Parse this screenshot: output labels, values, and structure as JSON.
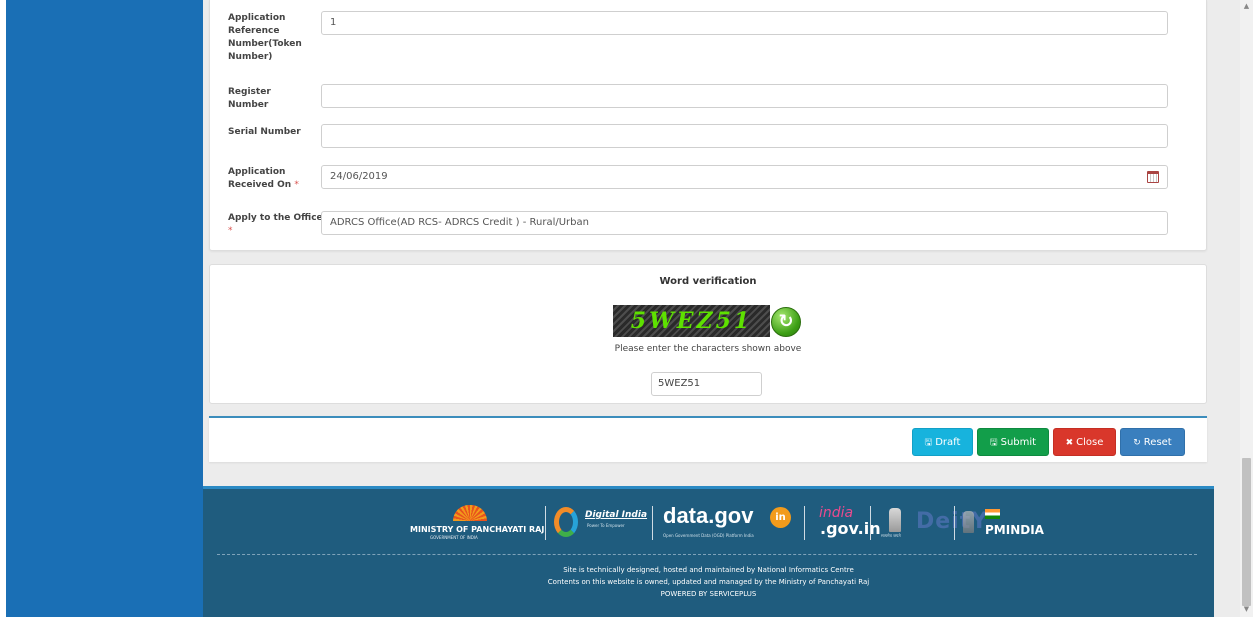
{
  "form": {
    "fields": [
      {
        "label": "Application Reference Number(Token Number)",
        "value": "1",
        "required": false
      },
      {
        "label": "Register Number",
        "value": "",
        "required": false
      },
      {
        "label": "Serial Number",
        "value": "",
        "required": false
      },
      {
        "label": "Application Received On",
        "value": "24/06/2019",
        "required": true,
        "icon": "calendar-icon"
      },
      {
        "label": "Apply to the Office",
        "value": "ADRCS Office(AD RCS- ADRCS Credit ) - Rural/Urban",
        "required": true
      }
    ],
    "required_mark": "*"
  },
  "captcha": {
    "title": "Word verification",
    "image_text": "5WEZ51",
    "hint": "Please enter the characters shown above",
    "input_value": "5WEZ51",
    "refresh_icon": "refresh-icon"
  },
  "actions": {
    "draft": "Draft",
    "submit": "Submit",
    "close": "Close",
    "reset": "Reset",
    "colors": {
      "draft": "#17b3dd",
      "submit": "#129e4a",
      "close": "#d9372b",
      "reset": "#3a7fbe"
    }
  },
  "footer": {
    "logos": {
      "mopr": "MINISTRY OF PANCHAYATI RAJ",
      "mopr_sub": "GOVERNMENT OF INDIA",
      "digital_india": "Digital India",
      "digital_india_sub": "Power To Empower",
      "datagov": "data.gov",
      "datagov_badge": "in",
      "datagov_sub": "Open Government Data (OGD) Platform India",
      "india_gov_top": "india",
      "india_gov_bottom": ".gov.in",
      "emblem_caption": "सत्यमेव जयते",
      "deity": "DeitY",
      "pmindia": "PMINDIA"
    },
    "line1": "Site is technically designed, hosted and maintained by National Informatics Centre",
    "line2": "Contents on this website is owned, updated and managed by the Ministry of Panchayati Raj",
    "line3": "POWERED BY SERVICEPLUS",
    "background": "#1f5c7e"
  },
  "theme": {
    "sidebar": "#1a6fb5",
    "accent": "#3c8dbc"
  }
}
